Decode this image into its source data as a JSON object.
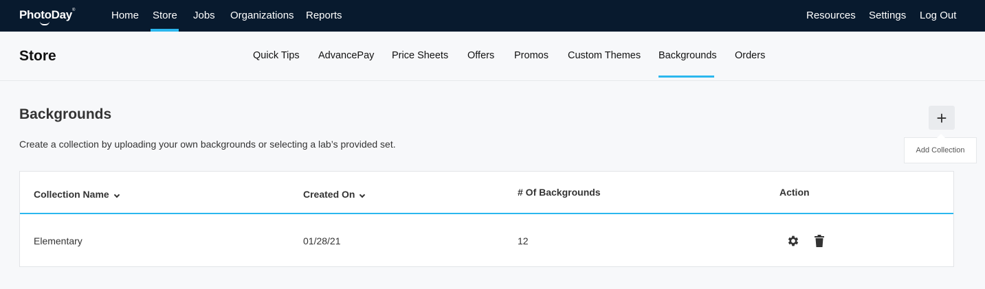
{
  "app": {
    "logo": "PhotoDay",
    "logo_mark": "®"
  },
  "topnav": {
    "left": [
      "Home",
      "Store",
      "Jobs",
      "Organizations",
      "Reports"
    ],
    "right": [
      "Resources",
      "Settings",
      "Log Out"
    ],
    "active": "Store"
  },
  "subheader": {
    "title": "Store",
    "tabs": [
      "Quick Tips",
      "AdvancePay",
      "Price Sheets",
      "Offers",
      "Promos",
      "Custom Themes",
      "Backgrounds",
      "Orders"
    ],
    "active": "Backgrounds"
  },
  "page": {
    "heading": "Backgrounds",
    "description": "Create a collection by uploading your own backgrounds or selecting a lab’s provided set.",
    "add_button_icon": "plus-icon",
    "add_tooltip": "Add Collection"
  },
  "table": {
    "columns": [
      "Collection Name",
      "Created On",
      "# Of Backgrounds",
      "Action"
    ],
    "rows": [
      {
        "name": "Elementary",
        "created_on": "01/28/21",
        "count": "12",
        "actions": [
          "gear-icon",
          "trash-icon"
        ]
      }
    ]
  },
  "colors": {
    "topbar": "#081a2e",
    "accent": "#2bb7ee",
    "background": "#f7f8fa"
  }
}
